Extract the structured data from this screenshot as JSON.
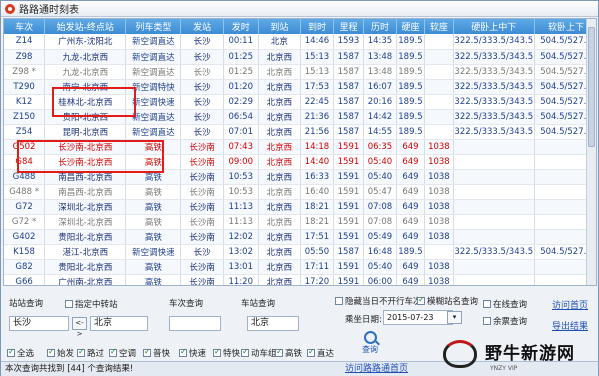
{
  "window": {
    "title": "路路通时刻表"
  },
  "columns": [
    "车次",
    "始发站-终点站",
    "列车类型",
    "发站",
    "发时",
    "到站",
    "到时",
    "里程",
    "历时",
    "硬座",
    "软座",
    "硬卧上中下",
    "软卧上下"
  ],
  "rows": [
    {
      "train": "Z14",
      "route": "广州东-沈阳北",
      "type": "新空调直达",
      "from": "长沙",
      "dep": "00:11",
      "to": "北京",
      "arr": "14:46",
      "km": "1593",
      "dur": "14:35",
      "hs": "189.5",
      "ss": "",
      "hb": "322.5/333.5/343.5",
      "sb": "504.5/527.5",
      "style": "normal"
    },
    {
      "train": "Z98",
      "route": "九龙-北京西",
      "type": "新空调直达",
      "from": "长沙",
      "dep": "01:25",
      "to": "北京西",
      "arr": "15:13",
      "km": "1587",
      "dur": "13:48",
      "hs": "189.5",
      "ss": "",
      "hb": "322.5/333.5/343.5",
      "sb": "504.5/527.5",
      "style": "normal"
    },
    {
      "train": "Z98 *",
      "route": "九龙-北京西",
      "type": "新空调直达",
      "from": "长沙",
      "dep": "01:25",
      "to": "北京西",
      "arr": "15:13",
      "km": "1587",
      "dur": "13:48",
      "hs": "189.5",
      "ss": "",
      "hb": "322.5/333.5/343.5",
      "sb": "504.5/527.5",
      "style": "grey"
    },
    {
      "train": "T290",
      "route": "南宁-北京西",
      "type": "新空调特快",
      "from": "长沙",
      "dep": "01:20",
      "to": "北京西",
      "arr": "17:53",
      "km": "1587",
      "dur": "16:07",
      "hs": "189.5",
      "ss": "",
      "hb": "322.5/333.5/343.5",
      "sb": "504.5/527.5",
      "style": "normal"
    },
    {
      "train": "K12",
      "route": "桂林北-北京西",
      "type": "新空调快速",
      "from": "长沙",
      "dep": "02:29",
      "to": "北京西",
      "arr": "22:45",
      "km": "1587",
      "dur": "20:16",
      "hs": "189.5",
      "ss": "",
      "hb": "322.5/333.5/343.5",
      "sb": "504.5/527.5",
      "style": "normal"
    },
    {
      "train": "Z150",
      "route": "贵阳-北京西",
      "type": "新空调直达",
      "from": "长沙",
      "dep": "06:54",
      "to": "北京西",
      "arr": "21:36",
      "km": "1587",
      "dur": "14:42",
      "hs": "189.5",
      "ss": "",
      "hb": "322.5/333.5/343.5",
      "sb": "504.5/527.5",
      "style": "normal"
    },
    {
      "train": "Z54",
      "route": "昆明-北京西",
      "type": "新空调直达",
      "from": "长沙",
      "dep": "07:01",
      "to": "北京西",
      "arr": "21:56",
      "km": "1587",
      "dur": "14:55",
      "hs": "189.5",
      "ss": "",
      "hb": "322.5/333.5/343.5",
      "sb": "504.5/527.5",
      "style": "normal"
    },
    {
      "train": "G502",
      "route": "长沙南-北京西",
      "type": "高铁",
      "from": "长沙南",
      "dep": "07:43",
      "to": "北京西",
      "arr": "14:18",
      "km": "1591",
      "dur": "06:35",
      "hs": "649",
      "ss": "1038",
      "hb": "",
      "sb": "",
      "style": "red"
    },
    {
      "train": "G84",
      "route": "长沙南-北京西",
      "type": "高铁",
      "from": "长沙南",
      "dep": "09:00",
      "to": "北京西",
      "arr": "14:40",
      "km": "1591",
      "dur": "05:40",
      "hs": "649",
      "ss": "1038",
      "hb": "",
      "sb": "",
      "style": "red"
    },
    {
      "train": "G488",
      "route": "南昌西-北京西",
      "type": "高铁",
      "from": "长沙南",
      "dep": "10:53",
      "to": "北京西",
      "arr": "16:33",
      "km": "1591",
      "dur": "05:40",
      "hs": "649",
      "ss": "1038",
      "hb": "",
      "sb": "",
      "style": "normal"
    },
    {
      "train": "G488 *",
      "route": "南昌西-北京西",
      "type": "高铁",
      "from": "长沙南",
      "dep": "10:53",
      "to": "北京西",
      "arr": "16:40",
      "km": "1591",
      "dur": "05:47",
      "hs": "649",
      "ss": "1038",
      "hb": "",
      "sb": "",
      "style": "grey"
    },
    {
      "train": "G72",
      "route": "深圳北-北京西",
      "type": "高铁",
      "from": "长沙南",
      "dep": "11:13",
      "to": "北京西",
      "arr": "18:21",
      "km": "1591",
      "dur": "07:08",
      "hs": "649",
      "ss": "1038",
      "hb": "",
      "sb": "",
      "style": "normal"
    },
    {
      "train": "G72 *",
      "route": "深圳北-北京西",
      "type": "高铁",
      "from": "长沙南",
      "dep": "11:13",
      "to": "北京西",
      "arr": "18:21",
      "km": "1591",
      "dur": "07:08",
      "hs": "649",
      "ss": "1038",
      "hb": "",
      "sb": "",
      "style": "grey"
    },
    {
      "train": "G402",
      "route": "贵阳北-北京西",
      "type": "高铁",
      "from": "长沙南",
      "dep": "12:02",
      "to": "北京西",
      "arr": "17:51",
      "km": "1591",
      "dur": "05:49",
      "hs": "649",
      "ss": "1038",
      "hb": "",
      "sb": "",
      "style": "normal"
    },
    {
      "train": "K158",
      "route": "湛江-北京西",
      "type": "新空调快速",
      "from": "长沙",
      "dep": "13:02",
      "to": "北京西",
      "arr": "05:50",
      "km": "1587",
      "dur": "16:48",
      "hs": "189.5",
      "ss": "",
      "hb": "322.5/333.5/343.5",
      "sb": "504.5/527.5",
      "style": "normal"
    },
    {
      "train": "G82",
      "route": "贵阳北-北京西",
      "type": "高铁",
      "from": "长沙南",
      "dep": "13:01",
      "to": "北京西",
      "arr": "17:11",
      "km": "1591",
      "dur": "05:40",
      "hs": "649",
      "ss": "1038",
      "hb": "",
      "sb": "",
      "style": "normal"
    },
    {
      "train": "G66",
      "route": "广州南-北京西",
      "type": "高铁",
      "from": "长沙南",
      "dep": "11:20",
      "to": "北京西",
      "arr": "17:20",
      "km": "1591",
      "dur": "06:00",
      "hs": "649",
      "ss": "1038",
      "hb": "",
      "sb": "",
      "style": "normal"
    }
  ],
  "panel": {
    "station_query_label": "站站查询",
    "transfer_label": "指定中转站",
    "from_value": "长沙",
    "swap_label": "<->",
    "to_value": "北京",
    "train_query_label": "车次查询",
    "train_value": "",
    "station_label": "车站查询",
    "station_value": "北京",
    "hide_label": "隐藏当日不开行车次",
    "fuzzy_label": "模糊站名查询",
    "online_label": "在线查询",
    "remain_label": "余票查询",
    "date_label": "乘坐日期:",
    "date_value": "2015-07-23",
    "query_label": "查询",
    "home_link": "访问首页",
    "export_link": "导出结果",
    "filters": [
      "全选",
      "始发",
      "路过",
      "空调",
      "普快",
      "快速",
      "特快",
      "动车组",
      "高铁",
      "直达"
    ]
  },
  "status": {
    "text": "本次查询共找到 [44] 个查询结果!",
    "link": "访问路路通首页"
  },
  "watermark": {
    "text": "野牛新游网",
    "sub": "YNZY VIP"
  }
}
